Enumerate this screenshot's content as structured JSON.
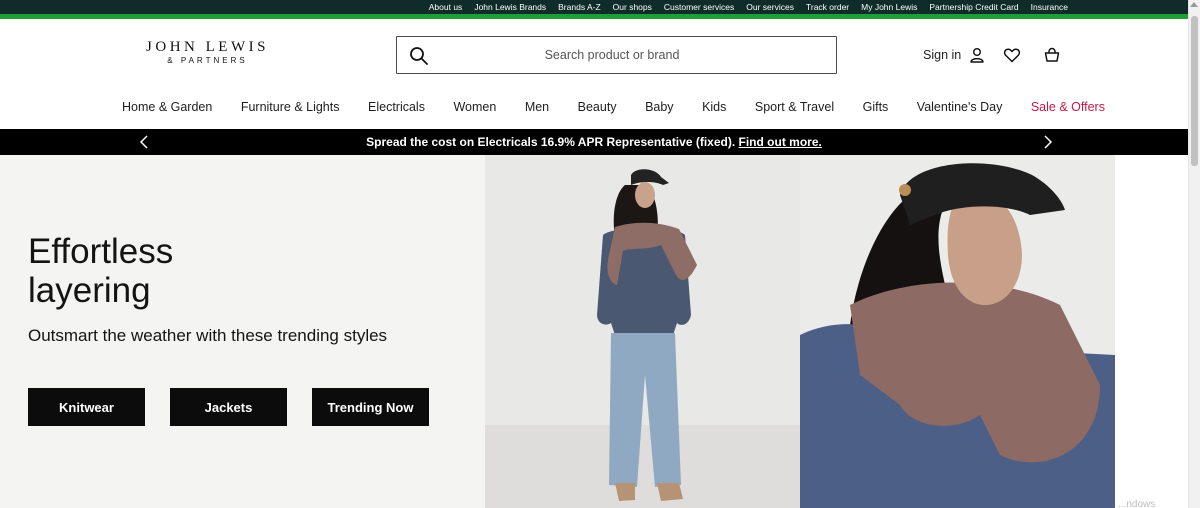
{
  "utility_links": [
    "About us",
    "John Lewis Brands",
    "Brands A-Z",
    "Our shops",
    "Customer services",
    "Our services",
    "Track order",
    "My John Lewis",
    "Partnership Credit Card",
    "Insurance"
  ],
  "logo": {
    "main": "JOHN LEWIS",
    "sub": "& PARTNERS"
  },
  "search": {
    "placeholder": "Search product or brand"
  },
  "account": {
    "sign_in": "Sign in"
  },
  "nav": [
    "Home & Garden",
    "Furniture & Lights",
    "Electricals",
    "Women",
    "Men",
    "Beauty",
    "Baby",
    "Kids",
    "Sport & Travel",
    "Gifts",
    "Valentine's Day",
    "Sale & Offers"
  ],
  "promo": {
    "text": "Spread the cost on Electricals 16.9% APR Representative (fixed).",
    "link": "Find out more."
  },
  "hero": {
    "title": "Effortless layering",
    "subtitle": "Outsmart the weather with these trending styles",
    "buttons": [
      "Knitwear",
      "Jackets",
      "Trending Now"
    ]
  },
  "watermark": "...ndows",
  "colors": {
    "utility_bg": "#0f2c2a",
    "stripe": "#1f9e38",
    "sale": "#c21a42",
    "promo_bg": "#000000"
  }
}
